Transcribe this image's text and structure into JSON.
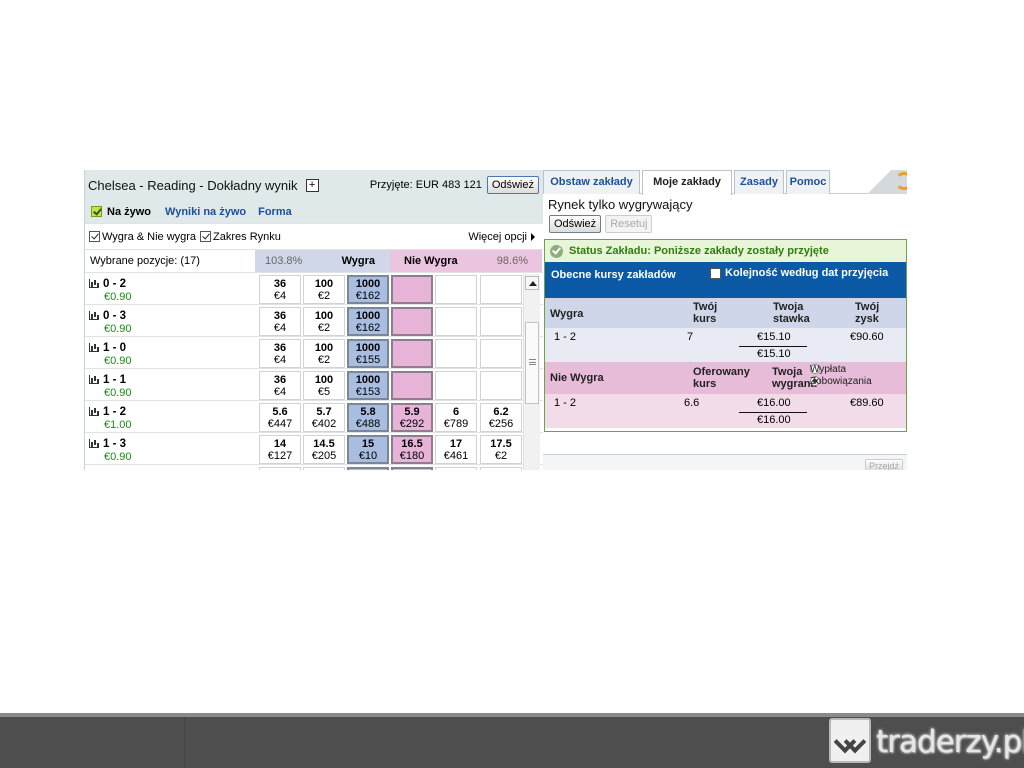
{
  "market": {
    "title": "Chelsea - Reading - Dokładny wynik",
    "plus": "+",
    "accepted": "Przyjęte: EUR 483 121",
    "refresh": "Odśwież",
    "live_label": "Na żywo",
    "live_results": "Wyniki na żywo",
    "form": "Forma",
    "opt_back_lay": "Wygra & Nie wygra",
    "opt_range": "Zakres Rynku",
    "more_options": "Więcej opcji",
    "selected_positions": "Wybrane pozycje:  (17)",
    "back_pct": "103.8%",
    "back_label": "Wygra",
    "lay_label": "Nie Wygra",
    "lay_pct": "98.6%",
    "rows": [
      {
        "name": "0 - 2",
        "pnl": "€0.90",
        "cells": [
          {
            "o": "36",
            "a": "€4"
          },
          {
            "o": "100",
            "a": "€2"
          },
          {
            "o": "1000",
            "a": "€162"
          },
          {
            "o": "",
            "a": ""
          },
          {
            "o": "",
            "a": ""
          },
          {
            "o": "",
            "a": ""
          }
        ]
      },
      {
        "name": "0 - 3",
        "pnl": "€0.90",
        "cells": [
          {
            "o": "36",
            "a": "€4"
          },
          {
            "o": "100",
            "a": "€2"
          },
          {
            "o": "1000",
            "a": "€162"
          },
          {
            "o": "",
            "a": ""
          },
          {
            "o": "",
            "a": ""
          },
          {
            "o": "",
            "a": ""
          }
        ]
      },
      {
        "name": "1 - 0",
        "pnl": "€0.90",
        "cells": [
          {
            "o": "36",
            "a": "€4"
          },
          {
            "o": "100",
            "a": "€2"
          },
          {
            "o": "1000",
            "a": "€155"
          },
          {
            "o": "",
            "a": ""
          },
          {
            "o": "",
            "a": ""
          },
          {
            "o": "",
            "a": ""
          }
        ]
      },
      {
        "name": "1 - 1",
        "pnl": "€0.90",
        "cells": [
          {
            "o": "36",
            "a": "€4"
          },
          {
            "o": "100",
            "a": "€5"
          },
          {
            "o": "1000",
            "a": "€153"
          },
          {
            "o": "",
            "a": ""
          },
          {
            "o": "",
            "a": ""
          },
          {
            "o": "",
            "a": ""
          }
        ]
      },
      {
        "name": "1 - 2",
        "pnl": "€1.00",
        "cells": [
          {
            "o": "5.6",
            "a": "€447"
          },
          {
            "o": "5.7",
            "a": "€402"
          },
          {
            "o": "5.8",
            "a": "€488"
          },
          {
            "o": "5.9",
            "a": "€292"
          },
          {
            "o": "6",
            "a": "€789"
          },
          {
            "o": "6.2",
            "a": "€256"
          }
        ]
      },
      {
        "name": "1 - 3",
        "pnl": "€0.90",
        "cells": [
          {
            "o": "14",
            "a": "€127"
          },
          {
            "o": "14.5",
            "a": "€205"
          },
          {
            "o": "15",
            "a": "€10"
          },
          {
            "o": "16.5",
            "a": "€180"
          },
          {
            "o": "17",
            "a": "€461"
          },
          {
            "o": "17.5",
            "a": "€2"
          }
        ]
      }
    ]
  },
  "betslip": {
    "tabs": [
      "Obstaw zakłady",
      "Moje zakłady",
      "Zasady",
      "Pomoc"
    ],
    "active_tab": "Moje zakłady",
    "market_title": "Rynek tylko wygrywający",
    "refresh": "Odśwież",
    "reset": "Resetuj",
    "status": "Status Zakładu: Poniższe zakłady zostały przyjęte",
    "current_odds": "Obecne kursy zakładów",
    "order_by_date": "Kolejność według dat przyjęcia",
    "back": {
      "head": "Wygra",
      "col_odds_1": "Twój",
      "col_odds_2": "kurs",
      "col_stake_1": "Twoja",
      "col_stake_2": "stawka",
      "col_profit_1": "Twój",
      "col_profit_2": "zysk",
      "selection": "1 - 2",
      "odds": "7",
      "stake": "€15.10",
      "profit": "€90.60",
      "total": "€15.10"
    },
    "lay": {
      "head": "Nie Wygra",
      "col_odds_1": "Oferowany",
      "col_odds_2": "kurs",
      "col_stake_1": "Twoja",
      "col_stake_2": "wygrana",
      "radio_payout": "Wypłata",
      "radio_liability": "Zobowiązania",
      "selection": "1 - 2",
      "odds": "6.6",
      "stake": "€16.00",
      "profit": "€89.60",
      "total": "€16.00"
    },
    "bottom_btn": "Przejdź"
  },
  "footer": {
    "logo_text": "traderzy.pl"
  }
}
